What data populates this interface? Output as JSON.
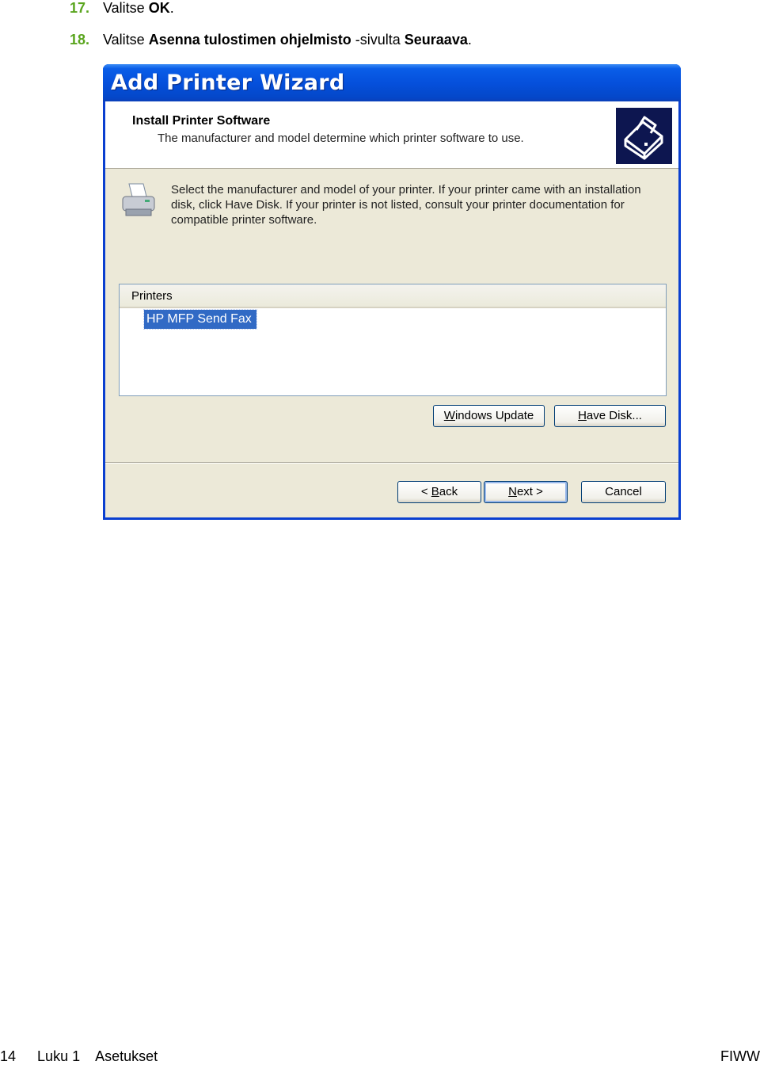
{
  "steps": [
    {
      "number": "17.",
      "pre": "Valitse ",
      "bold1": "OK",
      "mid": "",
      "bold2": "",
      "post": "."
    },
    {
      "number": "18.",
      "pre": "Valitse ",
      "bold1": "Asenna tulostimen ohjelmisto",
      "mid": " -sivulta ",
      "bold2": "Seuraava",
      "post": "."
    }
  ],
  "dialog": {
    "title": "Add Printer Wizard",
    "header_title": "Install Printer Software",
    "header_subtitle": "The manufacturer and model determine which printer software to use.",
    "description": "Select the manufacturer and model of your printer. If your printer came with an installation disk, click Have Disk. If your printer is not listed, consult your printer documentation for compatible printer software.",
    "list_header": "Printers",
    "list_items": [
      "HP MFP Send Fax"
    ],
    "buttons": {
      "windows_update": {
        "pre": "",
        "key": "W",
        "post": "indows Update"
      },
      "have_disk": {
        "pre": "",
        "key": "H",
        "post": "ave Disk..."
      },
      "back": {
        "pre": "< ",
        "key": "B",
        "post": "ack"
      },
      "next": {
        "pre": "",
        "key": "N",
        "post": "ext >"
      },
      "cancel": "Cancel"
    }
  },
  "footer": {
    "page": "14",
    "chapter": "Luku 1",
    "section": "Asetukset",
    "right": "FIWW"
  },
  "colors": {
    "step_number": "#5aa51e",
    "titlebar": "#0550dc",
    "selection": "#316ac5",
    "dialog_bg": "#ece9d8"
  }
}
